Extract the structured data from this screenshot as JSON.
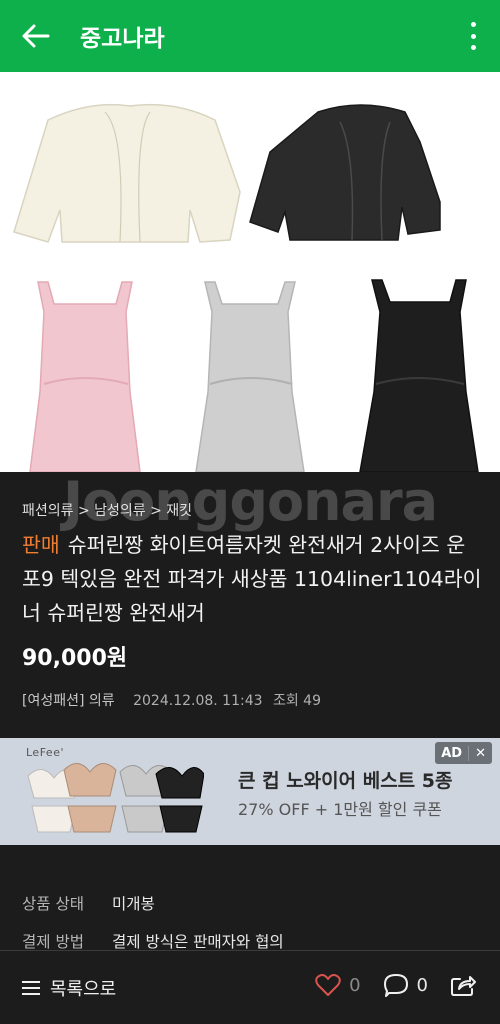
{
  "header": {
    "title": "중고나라"
  },
  "product": {
    "breadcrumb": "패션의류 > 남성의류 > 재킷",
    "status_tag": "판매",
    "title": "슈퍼린짱 화이트여름자켓 완전새거 2사이즈 운포9 텍있음 완전 파격가 새상품 1104liner1104라이너 슈퍼린짱 완전새거",
    "price": "90,000원",
    "category": "[여성패션] 의류",
    "date": "2024.12.08. 11:43",
    "views": "조회 49"
  },
  "watermark": "Joonggonara",
  "ad": {
    "brand": "LeFee'",
    "badge": "AD",
    "close": "✕",
    "title": "큰 컵 노와이어 베스트 5종",
    "subtitle": "27% OFF + 1만원 할인 쿠폰"
  },
  "details": [
    {
      "label": "상품 상태",
      "value": "미개봉"
    },
    {
      "label": "결제 방법",
      "value": "결제 방식은 판매자와 협의"
    }
  ],
  "bottom": {
    "list_label": "목록으로",
    "likes": "0",
    "comments": "0"
  },
  "colors": {
    "brand_green": "#0db04b",
    "status_orange": "#ef7d32"
  }
}
